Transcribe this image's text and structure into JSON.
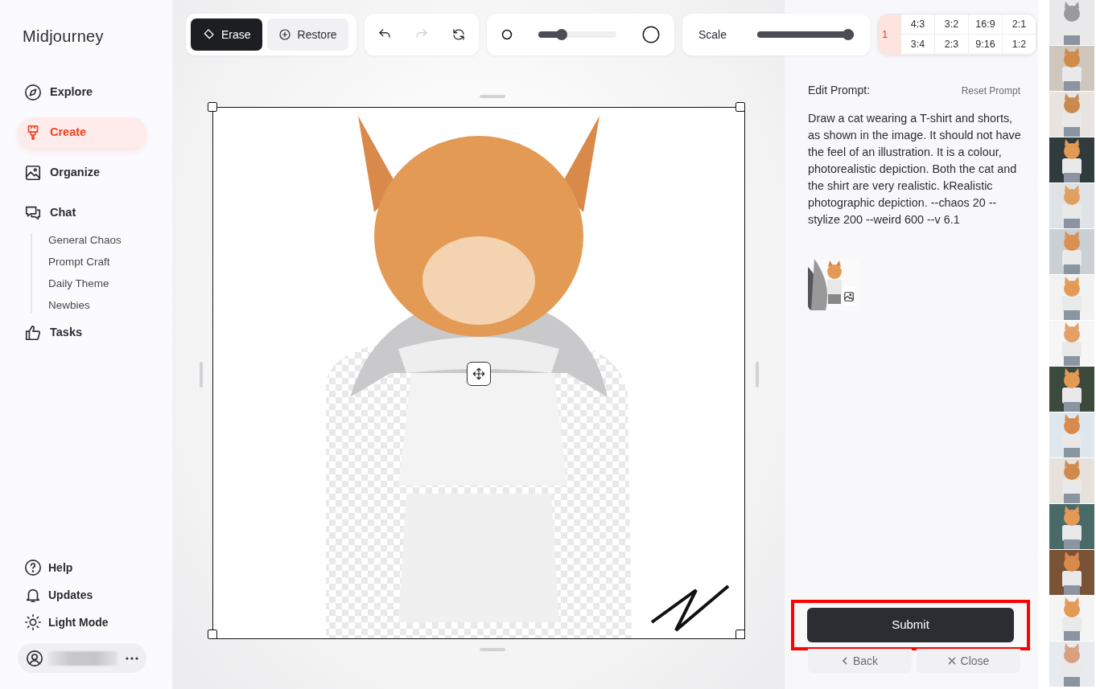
{
  "app": {
    "title": "Midjourney"
  },
  "nav": [
    {
      "label": "Explore",
      "selected": false
    },
    {
      "label": "Create",
      "selected": true
    },
    {
      "label": "Organize",
      "selected": false
    },
    {
      "label": "Chat",
      "selected": false,
      "children": [
        {
          "label": "General Chaos"
        },
        {
          "label": "Prompt Craft"
        },
        {
          "label": "Daily Theme"
        },
        {
          "label": "Newbies"
        }
      ]
    },
    {
      "label": "Tasks",
      "selected": false
    }
  ],
  "footer_links": [
    {
      "label": "Help"
    },
    {
      "label": "Updates"
    },
    {
      "label": "Light Mode"
    }
  ],
  "tools": [
    {
      "label": "Erase",
      "selected": true
    },
    {
      "label": "Restore",
      "selected": false
    }
  ],
  "actions": [
    {
      "kind": "undo",
      "disabled": false
    },
    {
      "kind": "redo",
      "disabled": true
    },
    {
      "kind": "reset",
      "disabled": false
    }
  ],
  "brush": {
    "level": 0.27
  },
  "scale": {
    "label": "Scale",
    "level": 1
  },
  "ratios": [
    {
      "label": "1",
      "selected": true
    },
    {
      "label": "4:3",
      "selected": false
    },
    {
      "label": "3:2",
      "selected": false
    },
    {
      "label": "16:9",
      "selected": false
    },
    {
      "label": "2:1",
      "selected": false
    },
    {
      "label": "3:4",
      "selected": false
    },
    {
      "label": "2:3",
      "selected": false
    },
    {
      "label": "9:16",
      "selected": false
    },
    {
      "label": "1:2",
      "selected": false
    }
  ],
  "prompt": {
    "heading": "Edit Prompt:",
    "reset": "Reset Prompt",
    "text": "Draw a cat wearing a T-shirt and shorts, as shown in the image. It should not have the feel of an illustration. It is a colour, photorealistic depiction. Both the cat and the shirt are very realistic. kRealistic photographic depiction. --chaos 20 --stylize 200 --weird 600 --v 6.1"
  },
  "submit": {
    "label": "Submit",
    "highlighted": true
  },
  "back": {
    "label": "Back"
  },
  "close": {
    "label": "Close"
  }
}
